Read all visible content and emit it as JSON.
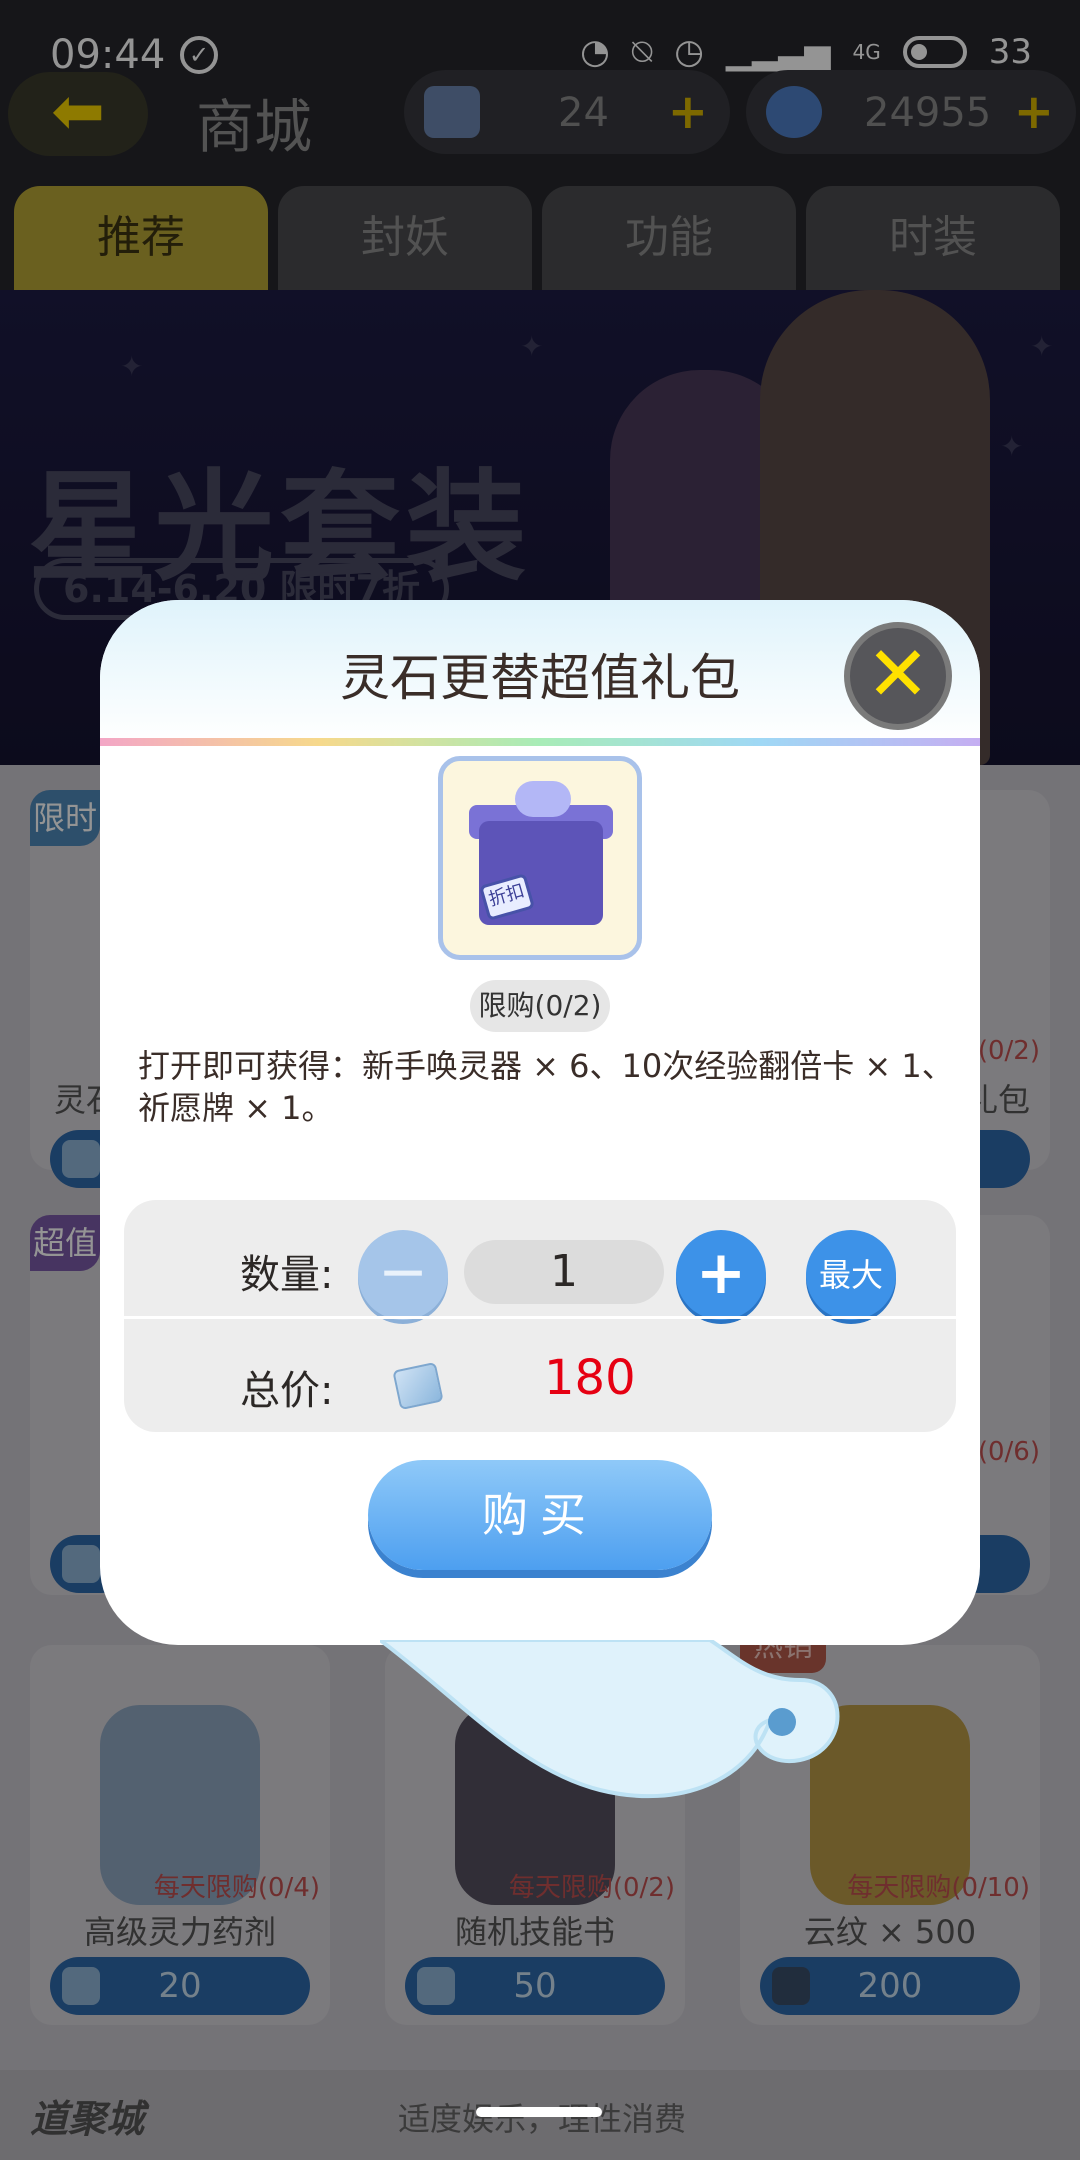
{
  "status_bar": {
    "time": "09:44",
    "network_label": "4G",
    "battery": "33"
  },
  "header": {
    "title": "商城",
    "currency_ticket": "24",
    "currency_diamond": "24955",
    "plus": "+"
  },
  "tabs": [
    {
      "label": "推荐"
    },
    {
      "label": "封妖"
    },
    {
      "label": "功能"
    },
    {
      "label": "时装"
    }
  ],
  "banner": {
    "title": "星光套装",
    "date": "6.14-6.20 限时7折"
  },
  "cards": {
    "row1_left": {
      "tag": "限时",
      "name": "灵石"
    },
    "row1_right": {
      "limit": "购(0/2)",
      "name": "礼包"
    },
    "row2_left": {
      "tag": "超值"
    },
    "row2_right": {
      "limit": "购(0/6)"
    },
    "row3": [
      {
        "name": "高级灵力药剂",
        "limit": "每天限购(0/4)",
        "price": "20"
      },
      {
        "name": "随机技能书",
        "limit": "每天限购(0/2)",
        "price": "50"
      },
      {
        "name": "云纹 × 500",
        "limit": "每天限购(0/10)",
        "price": "200",
        "hot": "热销"
      }
    ]
  },
  "footer": {
    "brand": "道聚城",
    "slogan": "适度娱乐，理性消费"
  },
  "dialog": {
    "title": "灵石更替超值礼包",
    "close": "✕",
    "gift_tag": "折扣",
    "limit_badge": "限购(0/2)",
    "description": "打开即可获得：新手唤灵器 × 6、10次经验翻倍卡 × 1、祈愿牌 × 1。",
    "quantity_label": "数量:",
    "minus": "−",
    "quantity_value": "1",
    "plus": "+",
    "max_label": "最大",
    "total_label": "总价:",
    "total_value": "180",
    "buy_label": "购买"
  },
  "colors": {
    "accent_blue": "#3d92e8",
    "price_red": "#e60012",
    "close_yellow": "#ffe100"
  }
}
